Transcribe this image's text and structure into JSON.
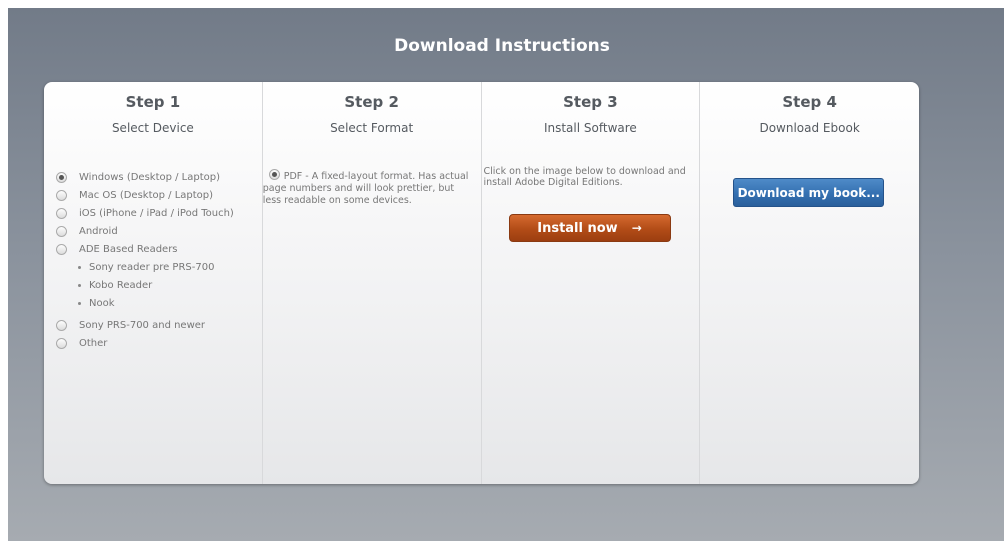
{
  "page": {
    "title": "Download Instructions"
  },
  "steps": [
    {
      "title": "Step 1",
      "subtitle": "Select Device",
      "options": [
        {
          "label": "Windows (Desktop / Laptop)",
          "checked": true
        },
        {
          "label": "Mac OS (Desktop / Laptop)",
          "checked": false
        },
        {
          "label": "iOS (iPhone / iPad / iPod Touch)",
          "checked": false
        },
        {
          "label": "Android",
          "checked": false
        },
        {
          "label": "ADE Based Readers",
          "checked": false
        },
        {
          "label": "Sony PRS-700 and newer",
          "checked": false
        },
        {
          "label": "Other",
          "checked": false
        }
      ],
      "ade_readers": [
        "Sony reader pre PRS-700",
        "Kobo Reader",
        "Nook"
      ]
    },
    {
      "title": "Step 2",
      "subtitle": "Select Format",
      "format": {
        "label": "PDF - A fixed-layout format. Has actual page numbers and will look prettier, but less readable on some devices.",
        "checked": true
      }
    },
    {
      "title": "Step 3",
      "subtitle": "Install Software",
      "info": "Click on the image below to download and install Adobe Digital Editions.",
      "button": {
        "label": "Install now",
        "arrow": "→"
      }
    },
    {
      "title": "Step 4",
      "subtitle": "Download Ebook",
      "button": {
        "label": "Download my book..."
      }
    }
  ],
  "colors": {
    "install_button": "#b24c17",
    "download_button": "#3470b1",
    "backdrop": "#7d8590"
  }
}
